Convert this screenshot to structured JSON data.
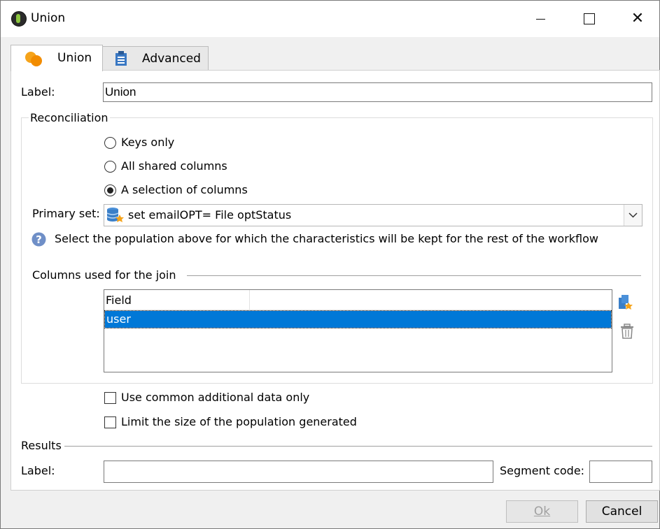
{
  "window": {
    "title": "Union",
    "minimize_glyph": "",
    "close_glyph": "✕"
  },
  "tabs": [
    {
      "label": "Union",
      "icon": "union-icon",
      "active": true
    },
    {
      "label": "Advanced",
      "icon": "clipboard-icon",
      "active": false
    }
  ],
  "label_field": {
    "label": "Label:",
    "value": "Union"
  },
  "reconciliation": {
    "title": "Reconciliation",
    "options": [
      {
        "label": "Keys only",
        "checked": false
      },
      {
        "label": "All shared columns",
        "checked": false
      },
      {
        "label": "A selection of columns",
        "checked": true
      }
    ],
    "primary_set": {
      "label": "Primary set:",
      "value": "set emailOPT= File optStatus"
    },
    "help_text": "Select the population above for which the characteristics will be kept for the rest of the workflow",
    "columns": {
      "title": "Columns used for the join",
      "header": "Field",
      "rows": [
        "user"
      ]
    }
  },
  "options": {
    "common_data": {
      "label": "Use common additional data only",
      "checked": false
    },
    "limit_size": {
      "label": "Limit the size of the population generated",
      "checked": false
    }
  },
  "results": {
    "title": "Results",
    "label": "Label:",
    "label_value": "",
    "segment_label": "Segment code:",
    "segment_value": ""
  },
  "buttons": {
    "ok": "Ok",
    "cancel": "Cancel"
  },
  "colors": {
    "selection": "#0078d7",
    "union_orange": "#f5a31a",
    "advanced_blue": "#3a78c3"
  }
}
